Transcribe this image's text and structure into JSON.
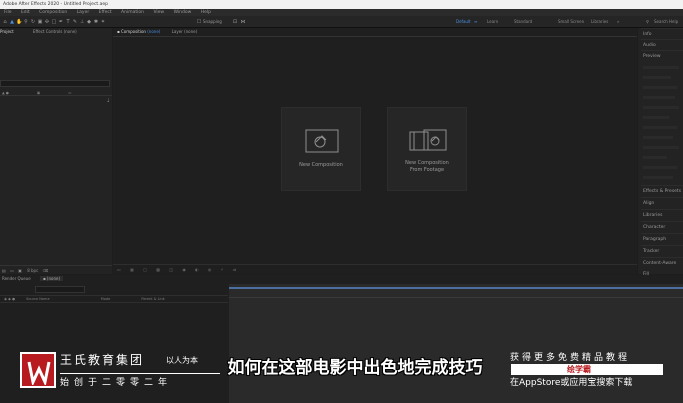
{
  "window": {
    "title": "Adobe After Effects 2020 - Untitled Project.aep"
  },
  "menu": [
    "File",
    "Edit",
    "Composition",
    "Layer",
    "Effect",
    "Animation",
    "View",
    "Window",
    "Help"
  ],
  "toolbar": {
    "snapping_label": "Snapping",
    "workspaces": [
      "Default",
      "Learn",
      "Standard",
      "Small Screen",
      "Libraries"
    ],
    "active_workspace": "Default",
    "search_placeholder": "Search Help"
  },
  "project_panel": {
    "tab_project": "Project",
    "tab_effect_controls": "Effect Controls (none)",
    "bpc": "8 bpc"
  },
  "composition_panel": {
    "tab_composition": "Composition",
    "tab_composition_sub": "(none)",
    "tab_layer": "Layer (none)",
    "new_comp_label": "New Composition",
    "new_comp_footage_label_1": "New Composition",
    "new_comp_footage_label_2": "From Footage"
  },
  "right_panel": {
    "items": [
      "Info",
      "Audio",
      "Preview",
      "Effects & Presets",
      "Align",
      "Libraries",
      "Character",
      "Paragraph",
      "Tracker",
      "Content-Aware Fill"
    ]
  },
  "timeline": {
    "tab_render_queue": "Render Queue",
    "tab_none": "(none)",
    "col_source_name": "Source Name",
    "col_mode": "Mode",
    "col_parent": "Parent & Link"
  },
  "overlay": {
    "brand_name": "王氏教育集团",
    "brand_tag": "以人为本",
    "motto": "始创于二零零二年",
    "subtitle": "如何在这部电影中出色地完成技巧",
    "ad_line1": "获得更多免费精品教程",
    "ad_badge": "绘学霸",
    "ad_line2": "在AppStore或应用宝搜索下载"
  },
  "colors": {
    "accent": "#4a8fe2",
    "brand_red": "#b81b1f",
    "panel_bg": "#232323"
  }
}
